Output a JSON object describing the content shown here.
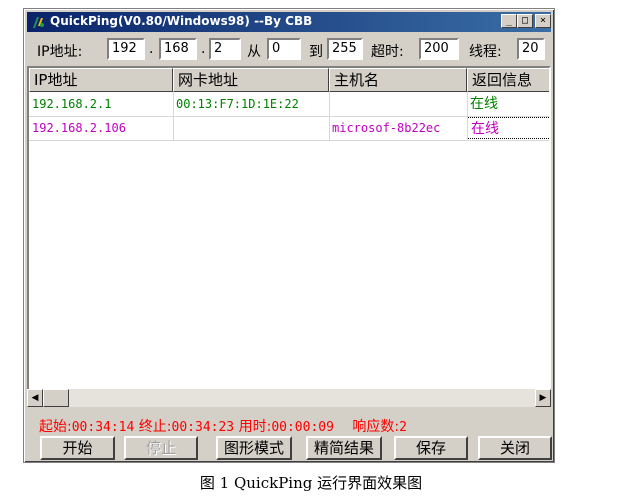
{
  "window": {
    "title": "QuickPing(V0.80/Windows98) --By CBB",
    "min_glyph": "_",
    "max_glyph": "□",
    "close_glyph": "×"
  },
  "toolbar": {
    "ip_label": "IP地址:",
    "ip_oct1": "192",
    "dot1": ".",
    "ip_oct2": "168",
    "dot2": ".",
    "ip_oct3": "2",
    "from_label": "从",
    "from_value": "0",
    "to_label": "到",
    "to_value": "255",
    "timeout_label": "超时:",
    "timeout_value": "200",
    "threads_label": "线程:",
    "threads_value": "20"
  },
  "table": {
    "headers": [
      "IP地址",
      "网卡地址",
      "主机名",
      "返回信息"
    ],
    "rows": [
      {
        "ip": "192.168.2.1",
        "mac": "00:13:F7:1D:1E:22",
        "host": "",
        "status": "在线",
        "color": "#008000"
      },
      {
        "ip": "192.168.2.106",
        "mac": "",
        "host": "microsof-8b22ec",
        "status": "在线",
        "color": "#c000c0"
      }
    ]
  },
  "scroll": {
    "left_glyph": "◀",
    "right_glyph": "▶"
  },
  "statusbar": {
    "start_label": "起始:",
    "start_value": "00:34:14",
    "end_label": "终止:",
    "end_value": "00:34:23",
    "elapsed_label": "用时:",
    "elapsed_value": "00:00:09",
    "responses_label": "响应数:",
    "responses_value": "2"
  },
  "buttons": {
    "start": "开始",
    "stop": "停止",
    "graph_mode": "图形模式",
    "compact": "精简结果",
    "save": "保存",
    "close": "关闭"
  },
  "caption": "图 1 QuickPing 运行界面效果图"
}
